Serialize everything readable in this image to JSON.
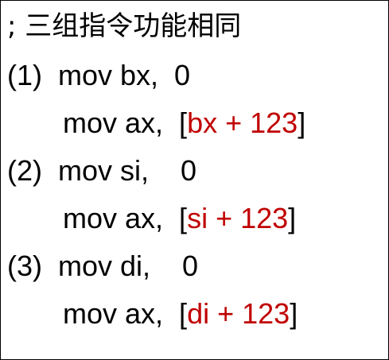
{
  "header": {
    "comment": "; 三组指令功能相同"
  },
  "groups": [
    {
      "label": "(1)",
      "first": "mov bx,  0",
      "second_prefix": "mov ax,  ",
      "open": "[",
      "operand": "bx + 123",
      "close": "]"
    },
    {
      "label": "(2)",
      "first": "mov si,    0",
      "second_prefix": "mov ax,  ",
      "open": "[",
      "operand": "si + 123",
      "close": "]"
    },
    {
      "label": "(3)",
      "first": "mov di,    0",
      "second_prefix": "mov ax,  ",
      "open": "[",
      "operand": "di + 123",
      "close": "]"
    }
  ],
  "colors": {
    "operand": "#c00000",
    "text": "#000000",
    "border": "#000000"
  }
}
